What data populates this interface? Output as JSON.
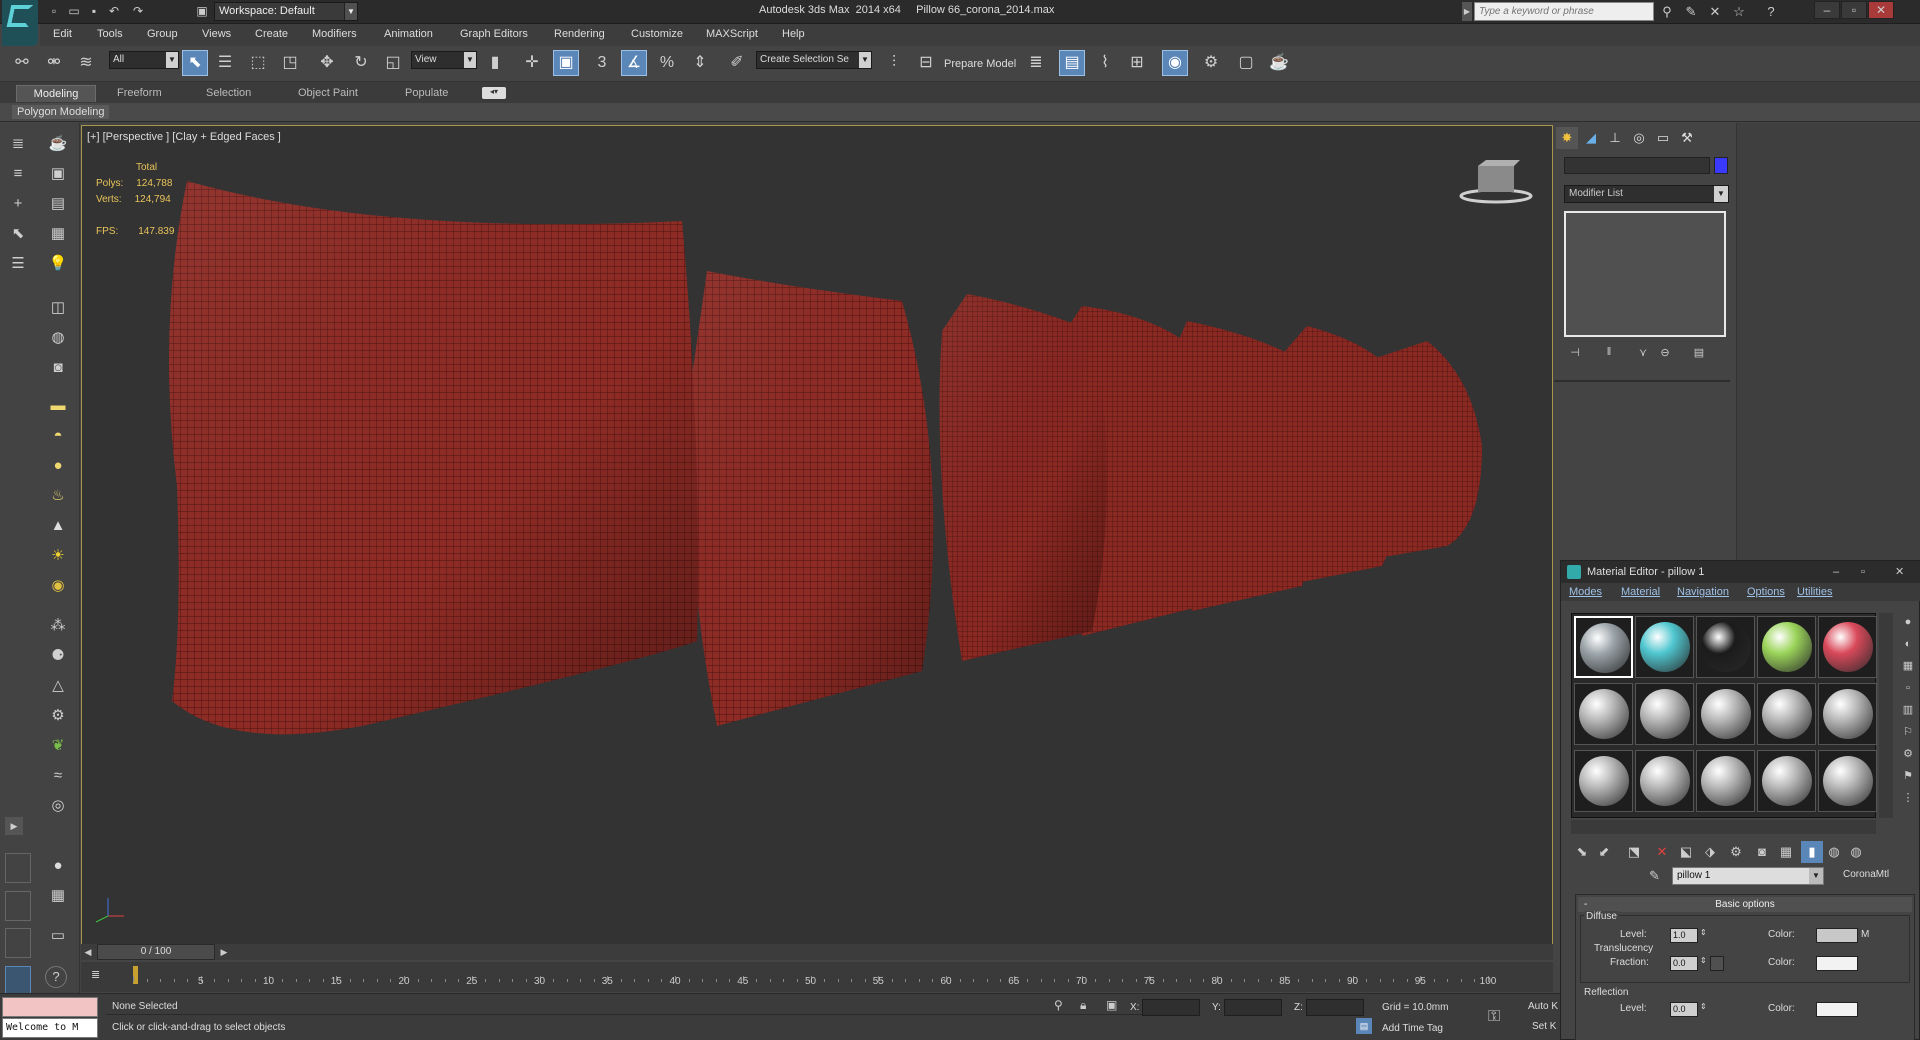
{
  "title_bar": {
    "workspace_label": "Workspace: Default",
    "app_title": "Autodesk 3ds Max  2014 x64     Pillow 66_corona_2014.max",
    "search_placeholder": "Type a keyword or phrase"
  },
  "menu": {
    "items": [
      "Edit",
      "Tools",
      "Group",
      "Views",
      "Create",
      "Modifiers",
      "Animation",
      "Graph Editors",
      "Rendering",
      "Customize",
      "MAXScript",
      "Help"
    ]
  },
  "toolbar": {
    "selection_filter": "All",
    "ref_coord": "View",
    "snap_value": "3",
    "named_selection": "Create Selection Se",
    "prepare_model": "Prepare Model"
  },
  "ribbon": {
    "tabs": [
      "Modeling",
      "Freeform",
      "Selection",
      "Object Paint",
      "Populate"
    ],
    "active_tab": "Modeling",
    "panel": "Polygon Modeling"
  },
  "viewport": {
    "label": "[+] [Perspective ] [Clay + Edged Faces ]",
    "stats_header": "Total",
    "polys_label": "Polys:",
    "polys_value": "124,788",
    "verts_label": "Verts:",
    "verts_value": "124,794",
    "fps_label": "FPS:",
    "fps_value": "147.839",
    "mesh_color": "#8f2a24"
  },
  "timeline": {
    "slider_text": "0 / 100",
    "ticks": [
      "5",
      "10",
      "15",
      "20",
      "25",
      "30",
      "35",
      "40",
      "45",
      "50",
      "55",
      "60",
      "65",
      "70",
      "75",
      "80",
      "85",
      "90",
      "95",
      "100"
    ]
  },
  "status": {
    "welcome": "Welcome to M",
    "selection_state": "None Selected",
    "prompt": "Click or click-and-drag to select objects",
    "x_label": "X:",
    "y_label": "Y:",
    "z_label": "Z:",
    "grid": "Grid = 10.0mm",
    "add_time_tag": "Add Time Tag",
    "auto_key": "Auto K",
    "set_key": "Set K"
  },
  "command_panel": {
    "modifier_list": "Modifier List"
  },
  "material_editor": {
    "title": "Material Editor - pillow 1",
    "menus": [
      "Modes",
      "Material",
      "Navigation",
      "Options",
      "Utilities"
    ],
    "material_name": "pillow 1",
    "material_type": "CoronaMtl",
    "rollout_title": "Basic options",
    "diffuse_group": "Diffuse",
    "level_label": "Level:",
    "diffuse_level": "1.0",
    "color_label": "Color:",
    "map_button": "M",
    "translucency_group": "Translucency",
    "fraction_label": "Fraction:",
    "fraction_value": "0.0",
    "reflection_group": "Reflection",
    "reflection_level": "0.0",
    "slot_colors": [
      "#9aa3a8",
      "#4fc6cf",
      "#1b1b1b",
      "#9bd45a",
      "#d9495a"
    ]
  }
}
